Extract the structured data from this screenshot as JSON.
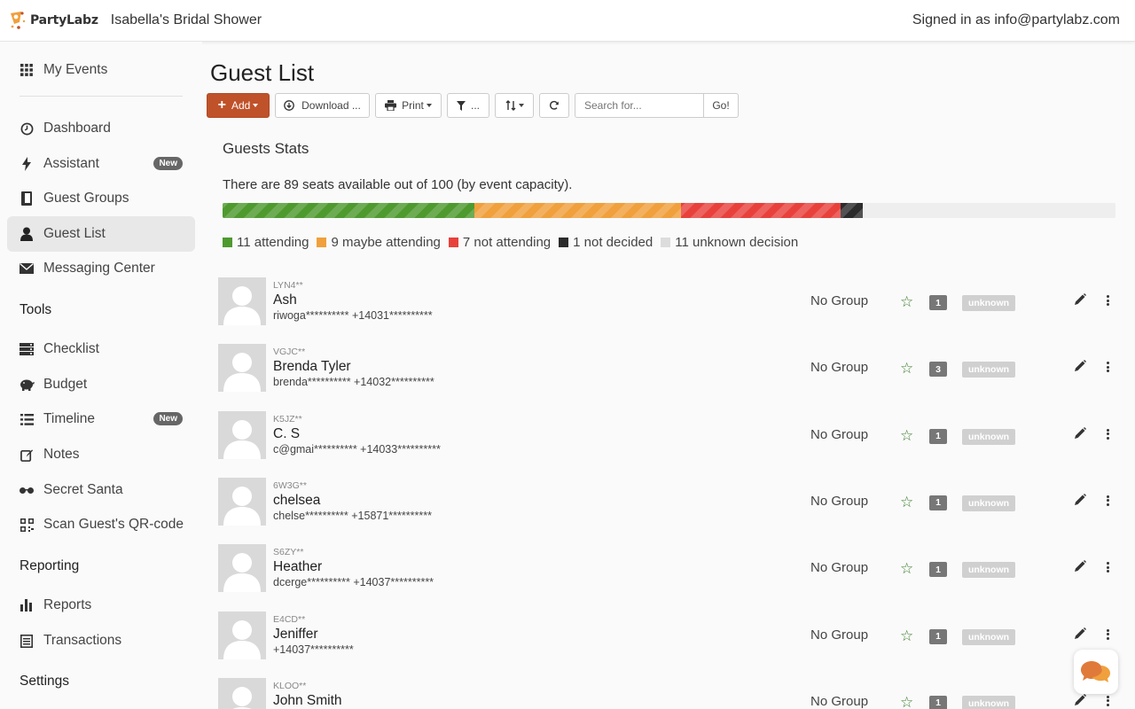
{
  "app": {
    "brand": "PartyLabz",
    "event_title": "Isabella's Bridal Shower",
    "signed_in": "Signed in as info@partylabz.com"
  },
  "sidebar": {
    "my_events": "My Events",
    "items": [
      {
        "label": "Dashboard",
        "icon": "clock-icon"
      },
      {
        "label": "Assistant",
        "icon": "bolt-icon",
        "badge": "New"
      },
      {
        "label": "Guest Groups",
        "icon": "book-icon"
      },
      {
        "label": "Guest List",
        "icon": "user-icon"
      },
      {
        "label": "Messaging Center",
        "icon": "envelope-icon"
      }
    ],
    "tools_heading": "Tools",
    "tools": [
      {
        "label": "Checklist",
        "icon": "server-icon"
      },
      {
        "label": "Budget",
        "icon": "piggy-bank-icon"
      },
      {
        "label": "Timeline",
        "icon": "list-icon",
        "badge": "New"
      },
      {
        "label": "Notes",
        "icon": "edit-icon"
      },
      {
        "label": "Secret Santa",
        "icon": "glasses-icon"
      },
      {
        "label": "Scan Guest's QR-code",
        "icon": "qrcode-icon"
      }
    ],
    "reporting_heading": "Reporting",
    "reporting": [
      {
        "label": "Reports",
        "icon": "bar-chart-icon"
      },
      {
        "label": "Transactions",
        "icon": "list-alt-icon"
      }
    ],
    "settings_heading": "Settings"
  },
  "main": {
    "title": "Guest List",
    "toolbar": {
      "add": "Add",
      "download": "Download ...",
      "print": "Print",
      "filter": "...",
      "search_placeholder": "Search for...",
      "go": "Go!"
    },
    "stats": {
      "title": "Guests Stats",
      "summary": "There are 89 seats available out of 100 (by event capacity).",
      "bar": [
        {
          "label": "11 attending",
          "fraction": 0.282,
          "color": "#4e9a2f"
        },
        {
          "label": "9 maybe attending",
          "fraction": 0.231,
          "color": "#f0a03c"
        },
        {
          "label": "7 not attending",
          "fraction": 0.179,
          "color": "#e8413c"
        },
        {
          "label": "1 not decided",
          "fraction": 0.025,
          "color": "#2c2c2c"
        },
        {
          "label": "11 unknown decision",
          "fraction": 0.283,
          "color": "#eeeeee"
        }
      ],
      "legend_colors": [
        "#4e9a2f",
        "#f0a03c",
        "#e8413c",
        "#2c2c2c",
        "#dcdcdc"
      ]
    },
    "guests": [
      {
        "code": "LYN4**",
        "name": "Ash",
        "contact": "riwoga********** +14031**********",
        "group": "No Group",
        "count": "1",
        "status": "unknown"
      },
      {
        "code": "VGJC**",
        "name": "Brenda Tyler",
        "contact": "brenda********** +14032**********",
        "group": "No Group",
        "count": "3",
        "status": "unknown"
      },
      {
        "code": "K5JZ**",
        "name": "C. S",
        "contact": "c@gmai********** +14033**********",
        "group": "No Group",
        "count": "1",
        "status": "unknown"
      },
      {
        "code": "6W3G**",
        "name": "chelsea",
        "contact": "chelse********** +15871**********",
        "group": "No Group",
        "count": "1",
        "status": "unknown"
      },
      {
        "code": "S6ZY**",
        "name": "Heather",
        "contact": "dcerge********** +14037**********",
        "group": "No Group",
        "count": "1",
        "status": "unknown"
      },
      {
        "code": "E4CD**",
        "name": "Jeniffer",
        "contact": "+14037**********",
        "group": "No Group",
        "count": "1",
        "status": "unknown"
      },
      {
        "code": "KLOO**",
        "name": "John Smith",
        "contact": "",
        "group": "No Group",
        "count": "1",
        "status": "unknown"
      }
    ]
  }
}
